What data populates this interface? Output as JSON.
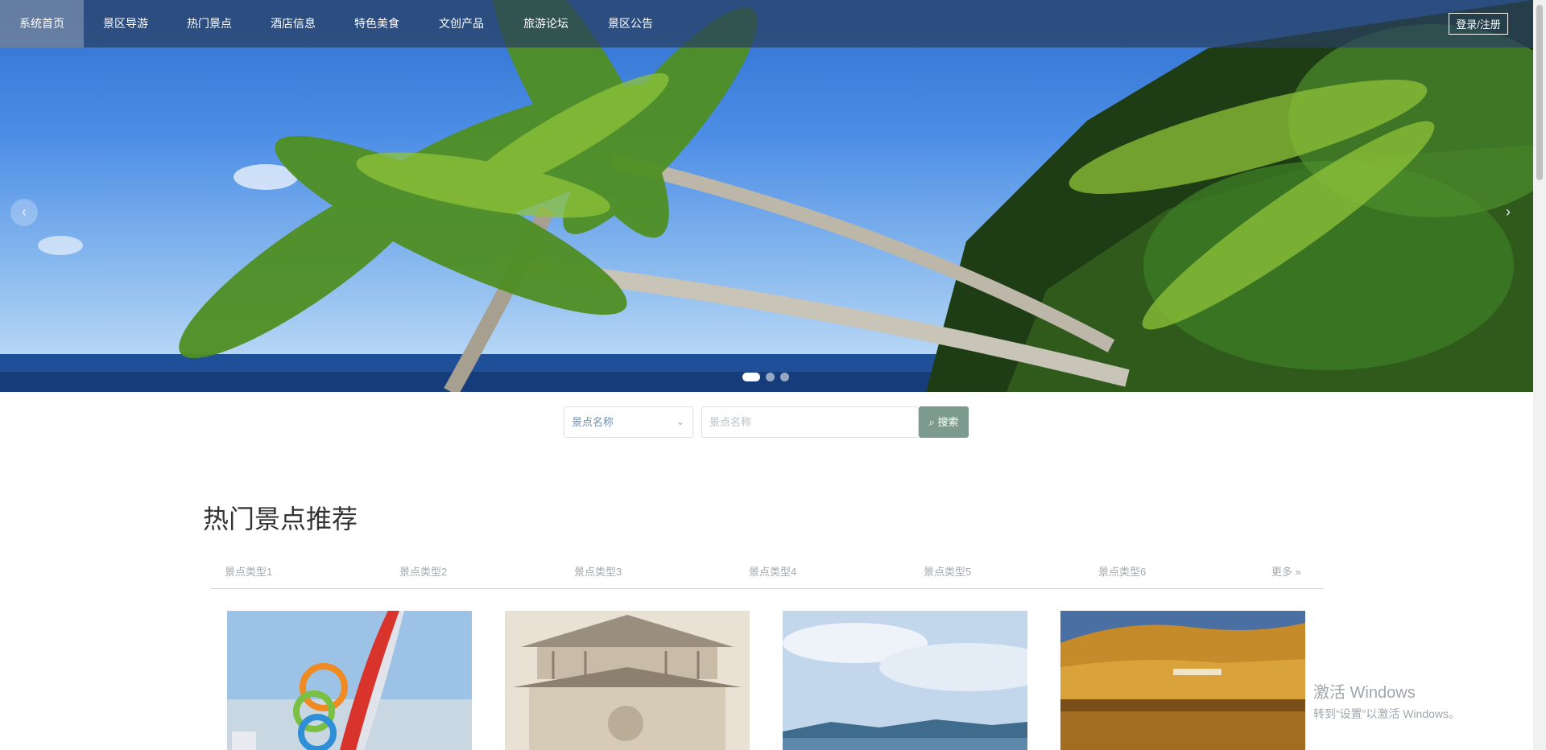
{
  "nav": {
    "items": [
      {
        "label": "系统首页",
        "active": true
      },
      {
        "label": "景区导游"
      },
      {
        "label": "热门景点"
      },
      {
        "label": "酒店信息"
      },
      {
        "label": "特色美食"
      },
      {
        "label": "文创产品"
      },
      {
        "label": "旅游论坛"
      },
      {
        "label": "景区公告"
      }
    ],
    "login_label": "登录/注册"
  },
  "carousel": {
    "prev_icon": "‹",
    "next_icon": "›",
    "slide_count": 3,
    "active_slide": 1
  },
  "search": {
    "select_value": "景点名称",
    "input_placeholder": "景点名称",
    "button_label": "搜索"
  },
  "section": {
    "title": "热门景点推荐",
    "tabs": [
      "景点类型1",
      "景点类型2",
      "景点类型3",
      "景点类型4",
      "景点类型5",
      "景点类型6"
    ],
    "more_label": "更多 »"
  },
  "watermark": {
    "line1": "激活 Windows",
    "line2": "转到“设置”以激活 Windows。"
  },
  "colors": {
    "nav_bg": "#283e60",
    "search_button": "#7d9a8f",
    "select_text": "#6b8fb5"
  }
}
